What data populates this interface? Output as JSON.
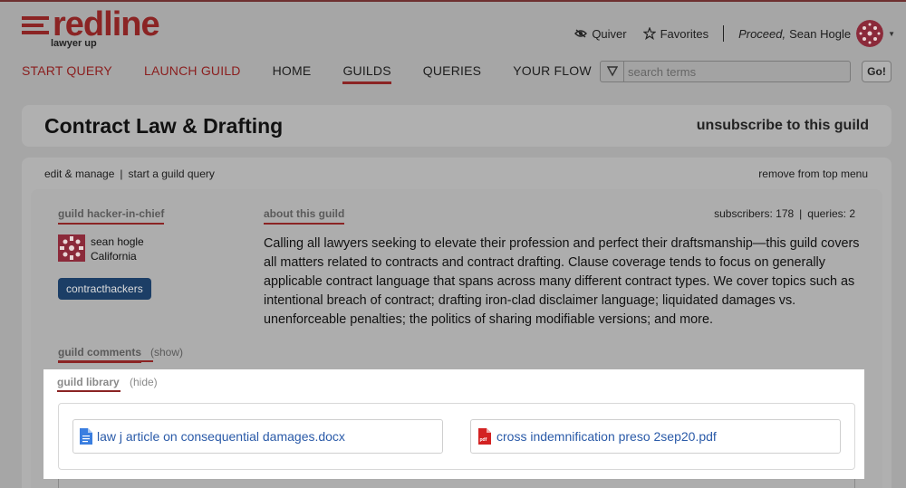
{
  "brand": {
    "name": "redline",
    "tagline": "lawyer up",
    "accent_color": "#8b2424"
  },
  "utility": {
    "quiver_label": "Quiver",
    "favorites_label": "Favorites",
    "greeting": "Proceed,",
    "user_name": "Sean Hogle"
  },
  "nav": {
    "start_query": "START QUERY",
    "launch_guild": "LAUNCH GUILD",
    "home": "HOME",
    "guilds": "GUILDS",
    "queries": "QUERIES",
    "your_flow": "YOUR FLOW",
    "active": "GUILDS"
  },
  "search": {
    "placeholder": "search terms",
    "go_label": "Go!"
  },
  "guild": {
    "title": "Contract Law & Drafting",
    "unsubscribe_label": "unsubscribe to this guild",
    "edit_manage_label": "edit & manage",
    "start_query_label": "start a guild query",
    "remove_label": "remove from top menu",
    "hacker_label": "guild hacker-in-chief",
    "owner_name": "sean hogle",
    "owner_location": "California",
    "tag": "contracthackers",
    "about_label": "about this guild",
    "subscribers": "subscribers: 178",
    "queries": "queries: 2",
    "description": "Calling all lawyers seeking to elevate their profession and perfect their draftsmanship—this guild covers all matters related to contracts and contract drafting. Clause coverage tends to focus on generally applicable contract language that spans across many different contract types. We cover topics such as intentional breach of contract; drafting iron-clad disclaimer language; liquidated damages vs. unenforceable penalties; the politics of sharing modifiable versions; and more.",
    "comments_label": "guild comments",
    "comments_toggle": "(show)"
  },
  "library": {
    "label": "guild library",
    "toggle": "(hide)",
    "files": [
      {
        "name": "law j article on consequential damages.docx",
        "icon": "docx-file-icon"
      },
      {
        "name": "cross indemnification preso 2sep20.pdf",
        "icon": "pdf-file-icon",
        "badge": "pdf"
      }
    ]
  }
}
